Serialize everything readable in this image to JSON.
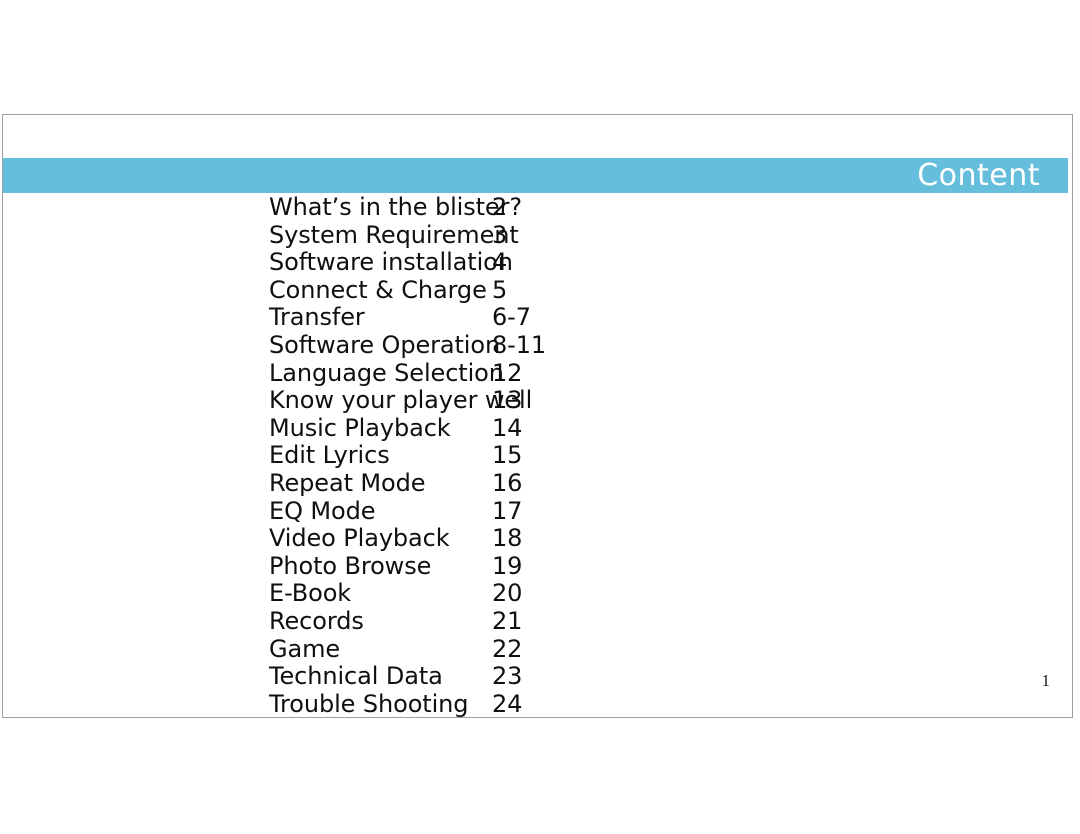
{
  "document": {
    "page_number": "1",
    "accent_color": "#65bedb",
    "text_color": "#101010",
    "title_color": "#ffffff",
    "border_color": "#9e9e9e"
  },
  "header": {
    "title": "Content"
  },
  "contents": {
    "entries": [
      {
        "label": "What’s in the blister?",
        "page": "2"
      },
      {
        "label": "System Requirement",
        "page": "3"
      },
      {
        "label": "Software installation",
        "page": "4"
      },
      {
        "label": "Connect & Charge",
        "page": "5"
      },
      {
        "label": "Transfer",
        "page": "6-7"
      },
      {
        "label": "Software Operation",
        "page": "8-11"
      },
      {
        "label": "Language Selection",
        "page": "12"
      },
      {
        "label": "Know your player well",
        "page": "13"
      },
      {
        "label": "Music Playback",
        "page": "14"
      },
      {
        "label": "Edit Lyrics",
        "page": "15"
      },
      {
        "label": "Repeat Mode",
        "page": "16"
      },
      {
        "label": "EQ Mode",
        "page": "17"
      },
      {
        "label": "Video Playback",
        "page": "18"
      },
      {
        "label": "Photo Browse",
        "page": "19"
      },
      {
        "label": "E-Book",
        "page": "20"
      },
      {
        "label": "Records",
        "page": "21"
      },
      {
        "label": "Game",
        "page": "22"
      },
      {
        "label": "Technical Data",
        "page": "23"
      },
      {
        "label": "Trouble Shooting",
        "page": "24"
      }
    ]
  }
}
